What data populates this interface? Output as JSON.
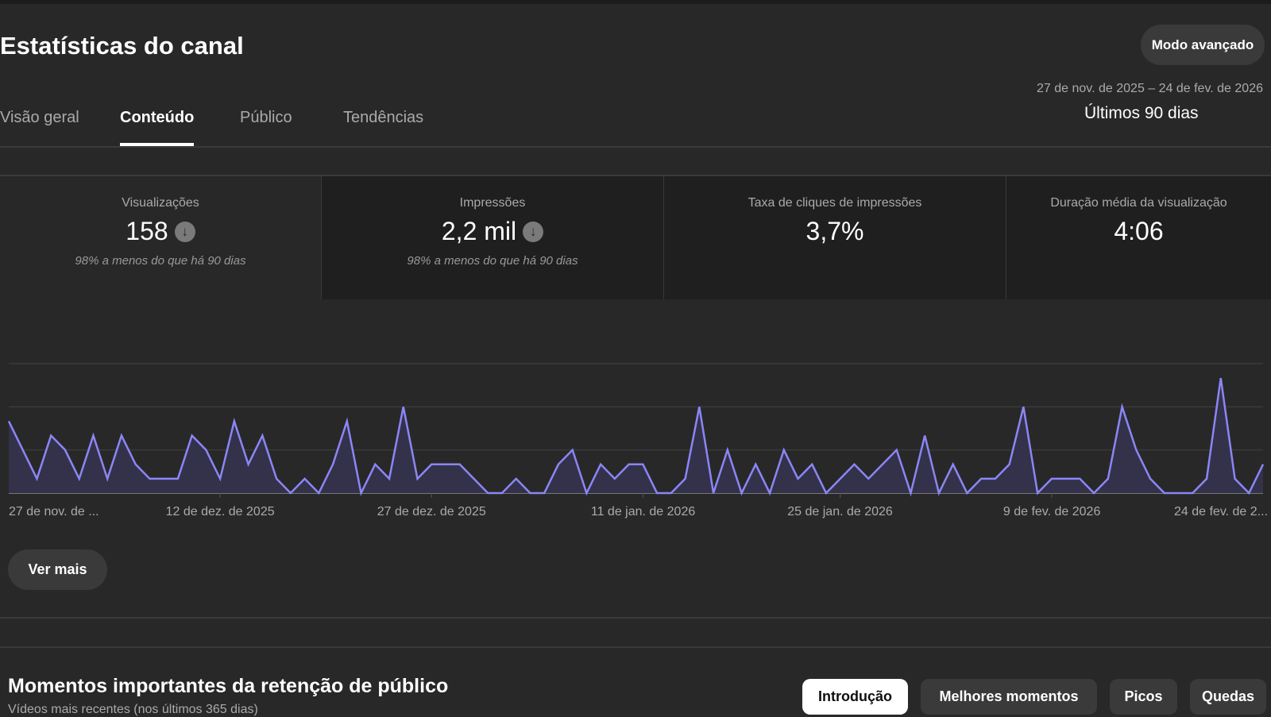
{
  "header": {
    "title": "Estatísticas do canal",
    "advanced_mode_label": "Modo avançado",
    "date_range": "27 de nov. de 2025 – 24 de fev. de 2026",
    "period": "Últimos 90 dias"
  },
  "tabs": [
    {
      "label": "Visão geral"
    },
    {
      "label": "Conteúdo",
      "active": true
    },
    {
      "label": "Público"
    },
    {
      "label": "Tendências"
    }
  ],
  "metrics": [
    {
      "label": "Visualizações",
      "value": "158",
      "trend": "down",
      "note": "98% a menos do que há 90 dias"
    },
    {
      "label": "Impressões",
      "value": "2,2 mil",
      "trend": "down",
      "note": "98% a menos do que há 90 dias"
    },
    {
      "label": "Taxa de cliques de impressões",
      "value": "3,7%"
    },
    {
      "label": "Duração média da visualização",
      "value": "4:06"
    }
  ],
  "down_glyph": "↓",
  "chart_data": {
    "type": "area",
    "title": "Visualizações",
    "ylim": [
      0,
      9
    ],
    "yticks": [
      0,
      3,
      6,
      9
    ],
    "grid": true,
    "line_color": "#8b86f5",
    "fill_color": "#33324a",
    "x_tick_labels": [
      {
        "day": 0,
        "label": "27 de nov. de ..."
      },
      {
        "day": 15,
        "label": "12 de dez. de 2025"
      },
      {
        "day": 30,
        "label": "27 de dez. de 2025"
      },
      {
        "day": 45,
        "label": "11 de jan. de 2026"
      },
      {
        "day": 59,
        "label": "25 de jan. de 2026"
      },
      {
        "day": 74,
        "label": "9 de fev. de 2026"
      },
      {
        "day": 89,
        "label": "24 de fev. de 2..."
      }
    ],
    "values": [
      5,
      3,
      1,
      4,
      3,
      1,
      4,
      1,
      4,
      2,
      1,
      1,
      1,
      4,
      3,
      1,
      5,
      2,
      4,
      1,
      0,
      1,
      0,
      2,
      5,
      0,
      2,
      1,
      6,
      1,
      2,
      2,
      2,
      1,
      0,
      0,
      1,
      0,
      0,
      2,
      3,
      0,
      2,
      1,
      2,
      2,
      0,
      0,
      1,
      6,
      0,
      3,
      0,
      2,
      0,
      3,
      1,
      2,
      0,
      1,
      2,
      1,
      2,
      3,
      0,
      4,
      0,
      2,
      0,
      1,
      1,
      2,
      6,
      0,
      1,
      1,
      1,
      0,
      1,
      6,
      3,
      1,
      0,
      0,
      0,
      1,
      8,
      1,
      0,
      2
    ]
  },
  "see_more_label": "Ver mais",
  "retention": {
    "title": "Momentos importantes da retenção de público",
    "subtitle": "Vídeos mais recentes (nos últimos 365 dias)",
    "chips": [
      {
        "label": "Introdução",
        "active": true
      },
      {
        "label": "Melhores momentos"
      },
      {
        "label": "Picos"
      },
      {
        "label": "Quedas"
      }
    ]
  }
}
